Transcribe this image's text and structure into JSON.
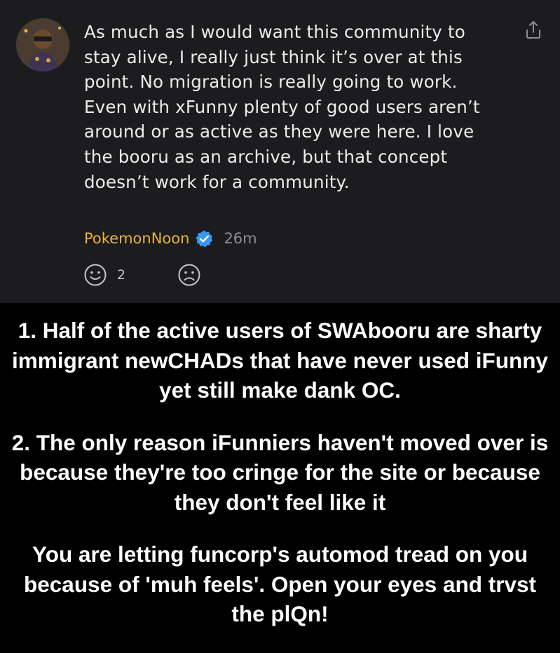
{
  "comment": {
    "text": "As much as I would want this community to stay alive, I really just think it’s over at this point. No migration is really going to work. Even with xFunny plenty of good users aren’t around or as active as they were here. I love the booru as an archive, but that concept doesn’t work for a community.",
    "author": "PokemonNoon",
    "timestamp": "26m",
    "reactions": {
      "smile_count": "2"
    },
    "icons": {
      "share": "share-icon",
      "verified": "verified-badge-icon",
      "smile": "smile-icon",
      "frown": "frown-icon",
      "avatar": "avatar-image"
    }
  },
  "caption": {
    "paragraph_1": "1. Half of the active users of SWAbooru are sharty immigrant newCHADs that have never used iFunny yet still make dank OC.",
    "paragraph_2": "2. The only reason iFunniers haven't moved over is because they're too cringe for the site or because they don't feel like it",
    "paragraph_3": "You are letting funcorp's automod tread on you because of 'muh feels'. Open your eyes and trvst the plQn!"
  },
  "colors": {
    "card_background": "#1c1c1e",
    "page_background": "#000000",
    "username": "#e9b43c",
    "verified_badge": "#3897f0",
    "comment_text": "#ececec",
    "muted_text": "#8e8e93",
    "caption_text": "#ffffff"
  }
}
